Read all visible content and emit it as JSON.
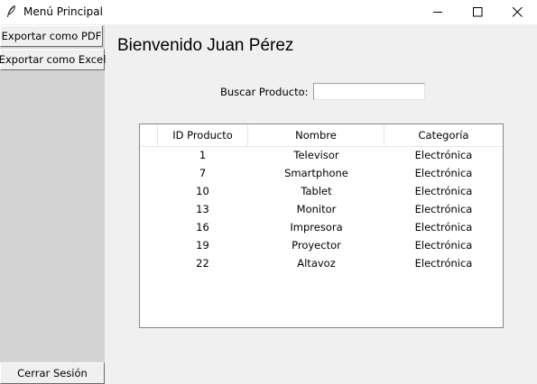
{
  "window": {
    "title": "Menú Principal",
    "feather_icon": "feather-icon",
    "minimize_icon": "minimize-icon",
    "maximize_icon": "maximize-icon",
    "close_icon": "close-icon"
  },
  "sidebar": {
    "export_pdf": "Exportar como PDF",
    "export_excel": "Exportar como Excel",
    "logout": "Cerrar Sesión",
    "bg_color": "#d3d3d3"
  },
  "main": {
    "welcome": "Bienvenido Juan Pérez",
    "search": {
      "label": "Buscar Producto:",
      "value": "",
      "placeholder": ""
    }
  },
  "table": {
    "columns": [
      "ID Producto",
      "Nombre",
      "Categoría"
    ],
    "rows": [
      {
        "id": "1",
        "nombre": "Televisor",
        "categoria": "Electrónica"
      },
      {
        "id": "7",
        "nombre": "Smartphone",
        "categoria": "Electrónica"
      },
      {
        "id": "10",
        "nombre": "Tablet",
        "categoria": "Electrónica"
      },
      {
        "id": "13",
        "nombre": "Monitor",
        "categoria": "Electrónica"
      },
      {
        "id": "16",
        "nombre": "Impresora",
        "categoria": "Electrónica"
      },
      {
        "id": "19",
        "nombre": "Proyector",
        "categoria": "Electrónica"
      },
      {
        "id": "22",
        "nombre": "Altavoz",
        "categoria": "Electrónica"
      }
    ]
  }
}
